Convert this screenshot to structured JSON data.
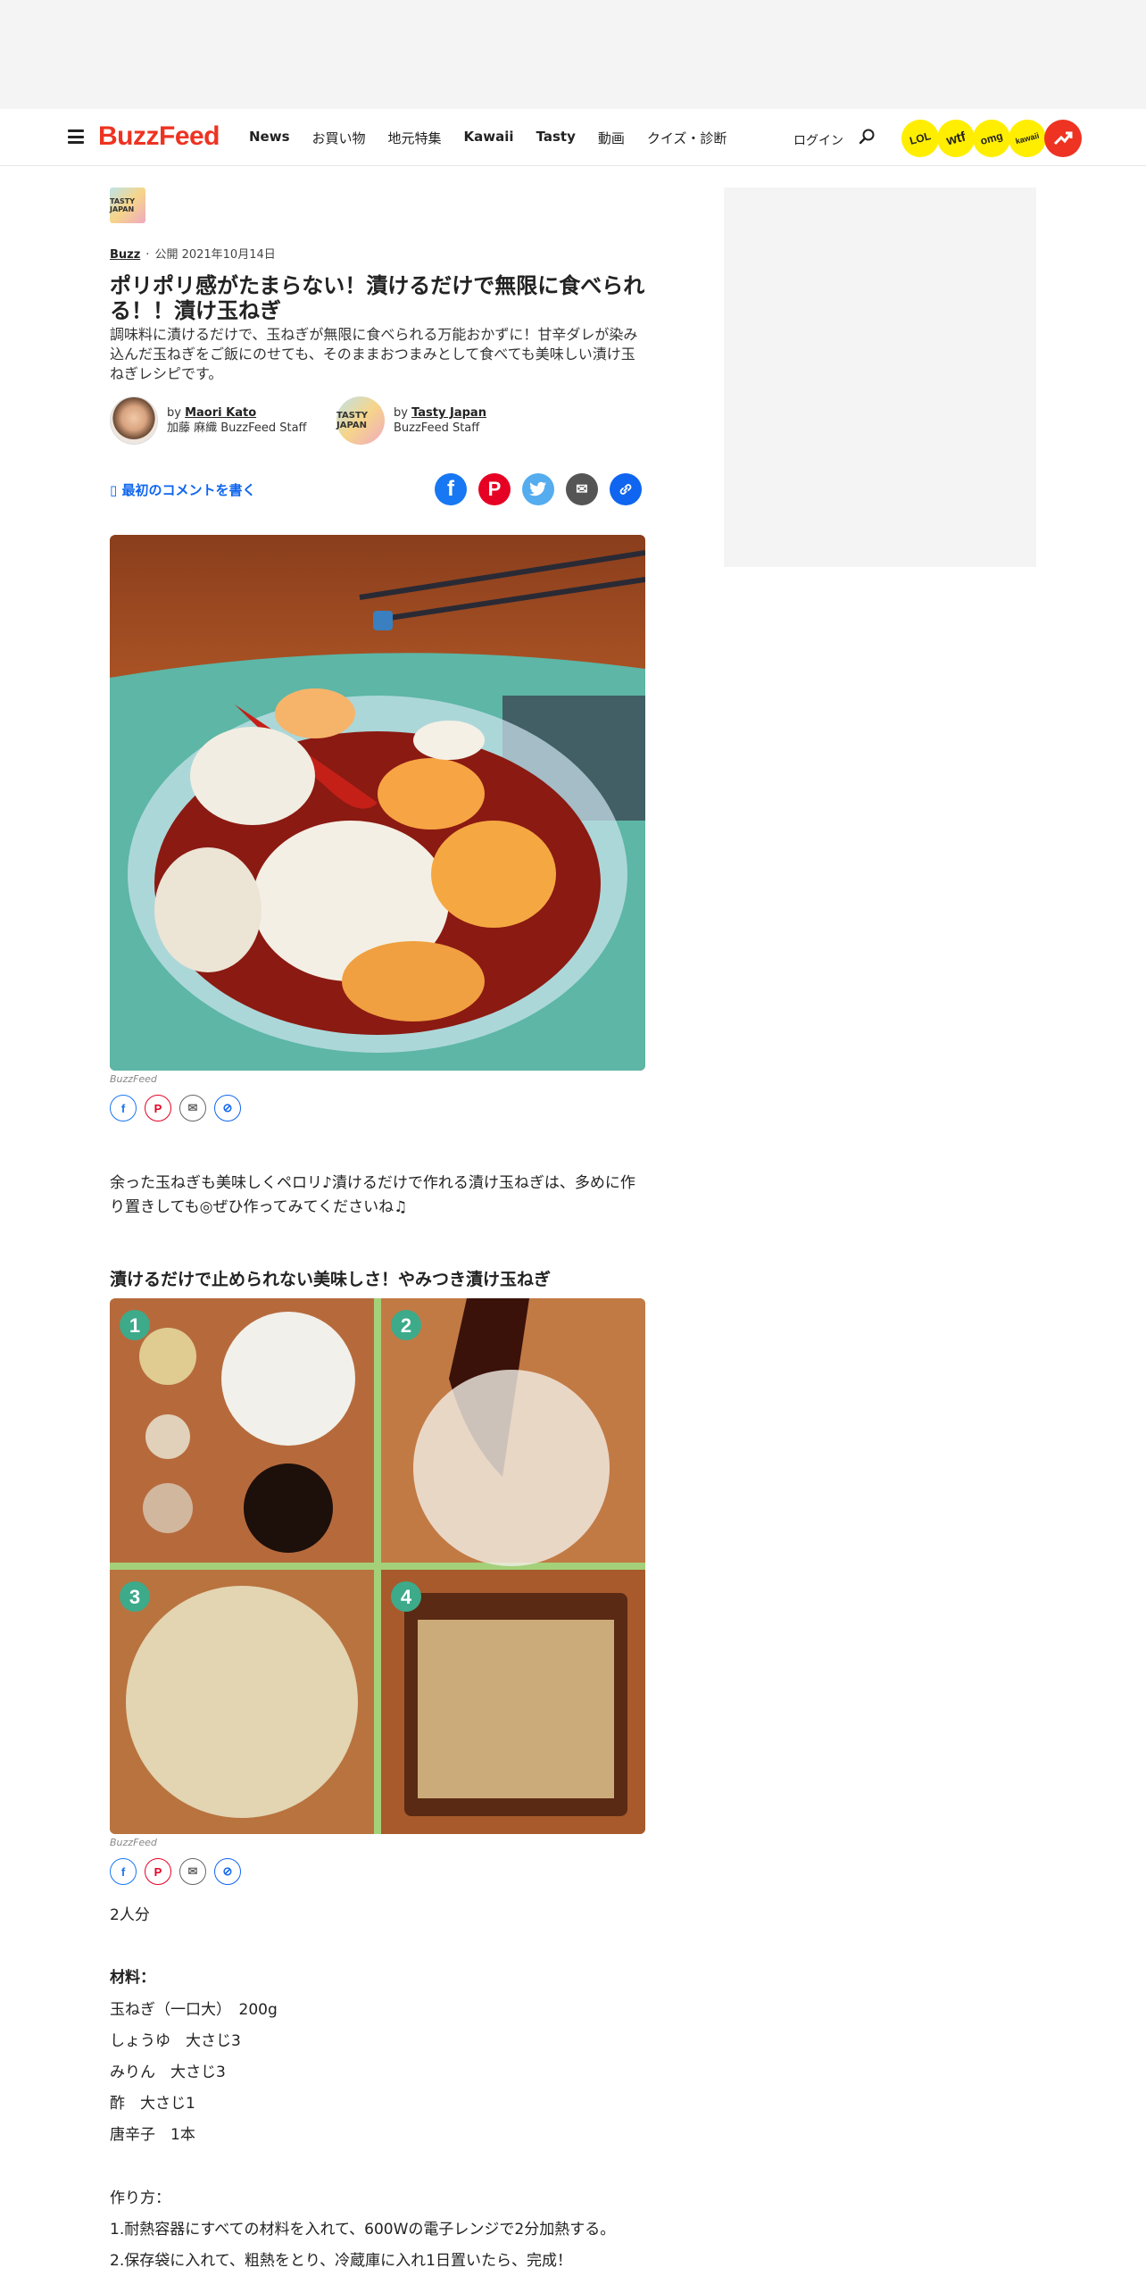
{
  "nav": {
    "logo": "BuzzFeed",
    "links": [
      "News",
      "お買い物",
      "地元特集",
      "Kawaii",
      "Tasty",
      "動画",
      "クイズ・診断"
    ],
    "login": "ログイン",
    "badges": [
      "LOL",
      "wtf",
      "omg",
      "kawaii"
    ]
  },
  "article": {
    "category_icon_text": "TASTY JAPAN",
    "category": "Buzz",
    "published": "公開 2021年10月14日",
    "title": "ポリポリ感がたまらない！漬けるだけで無限に食べられる！！漬け玉ねぎ",
    "description": "調味料に漬けるだけで、玉ねぎが無限に食べられる万能おかずに！甘辛ダレが染み込んだ玉ねぎをご飯にのせても、そのままおつまみとして食べても美味しい漬け玉ねぎレシピです。",
    "authors": [
      {
        "by": "by",
        "name": "Maori Kato",
        "sub": "加藤 麻織 BuzzFeed Staff"
      },
      {
        "by": "by",
        "name": "Tasty Japan",
        "sub": "BuzzFeed Staff",
        "avatar_text": "TASTY JAPAN"
      }
    ],
    "comment_link": "最初のコメントを書く",
    "image_credit": "BuzzFeed",
    "intro": "余った玉ねぎも美味しくペロリ♪漬けるだけで作れる漬け玉ねぎは、多めに作り置きしても◎ぜひ作ってみてくださいね♫",
    "subheading": "漬けるだけで止められない美味しさ！やみつき漬け玉ねぎ",
    "step_numbers": [
      "1",
      "2",
      "3",
      "4"
    ],
    "servings": "2人分",
    "ingredients_title": "材料：",
    "ingredients": [
      "玉ねぎ（一口大）　200g",
      "しょうゆ　大さじ3",
      "みりん　大さじ3",
      "酢　大さじ1",
      "唐辛子　1本"
    ],
    "method_title": "作り方：",
    "method": [
      "1.耐熱容器にすべての材料を入れて、600Wの電子レンジで2分加熱する。",
      "2.保存袋に入れて、粗熱をとり、冷蔵庫に入れ1日置いたら、完成！"
    ]
  }
}
